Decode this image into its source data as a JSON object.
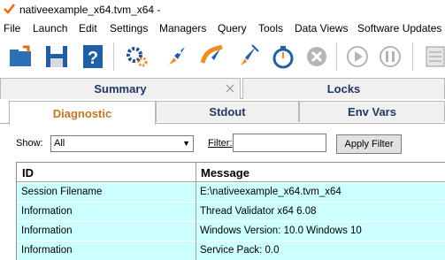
{
  "window": {
    "title": "nativeexample_x64.tvm_x64 -"
  },
  "menu": [
    "File",
    "Launch",
    "Edit",
    "Settings",
    "Managers",
    "Query",
    "Tools",
    "Data Views",
    "Software Updates"
  ],
  "toolbar": {
    "icons": [
      "open-folder-icon",
      "save-icon",
      "help-icon",
      "settings-gear-icon",
      "launch-rocket-icon",
      "attach-rocket-icon",
      "inject-rocket-icon",
      "timer-icon",
      "stop-icon",
      "play-icon",
      "pause-icon",
      "report-icon"
    ]
  },
  "tabs": {
    "row1": [
      {
        "label": "Summary"
      },
      {
        "label": "Locks"
      }
    ],
    "row2": [
      {
        "label": "Diagnostic",
        "active": true
      },
      {
        "label": "Stdout"
      },
      {
        "label": "Env Vars"
      }
    ]
  },
  "filter": {
    "show_label": "Show:",
    "show_value": "All",
    "filter_label": "Filter:",
    "filter_value": "",
    "apply_label": "Apply Filter"
  },
  "table": {
    "columns": [
      "ID",
      "Message"
    ],
    "rows": [
      [
        "Session Filename",
        "E:\\nativeexample_x64.tvm_x64"
      ],
      [
        "Information",
        "Thread Validator x64 6.08"
      ],
      [
        "Information",
        "Windows Version: 10.0 Windows 10"
      ],
      [
        "Information",
        "Service Pack: 0.0"
      ]
    ]
  },
  "colors": {
    "row_bg": "#ccffff",
    "tab_text": "#1f3864",
    "active_tab_text": "#c8761f"
  }
}
